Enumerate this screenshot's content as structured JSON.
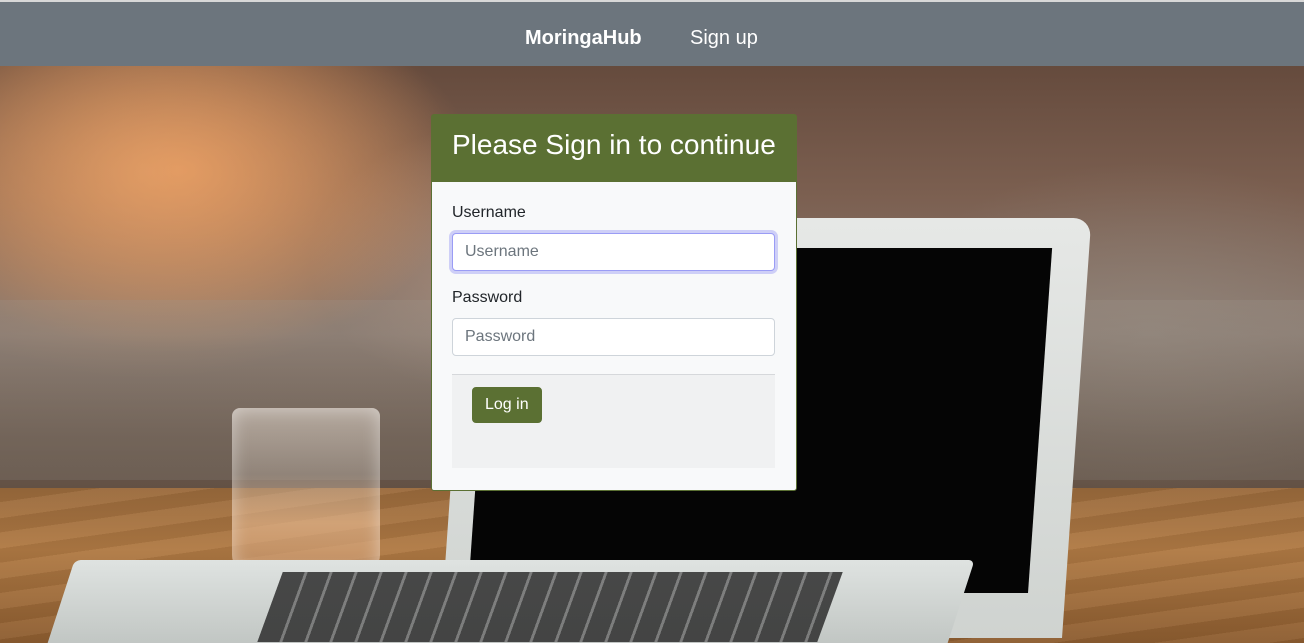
{
  "navbar": {
    "brand": "MoringaHub",
    "signup_link": "Sign up"
  },
  "login_card": {
    "title": "Please Sign in to continue",
    "username_label": "Username",
    "username_placeholder": "Username",
    "username_value": "",
    "password_label": "Password",
    "password_placeholder": "Password",
    "password_value": "",
    "submit_label": "Log in"
  },
  "colors": {
    "navbar_bg": "#6c757d",
    "accent_green": "#5b7033",
    "focus_ring": "#9a9cf5"
  }
}
